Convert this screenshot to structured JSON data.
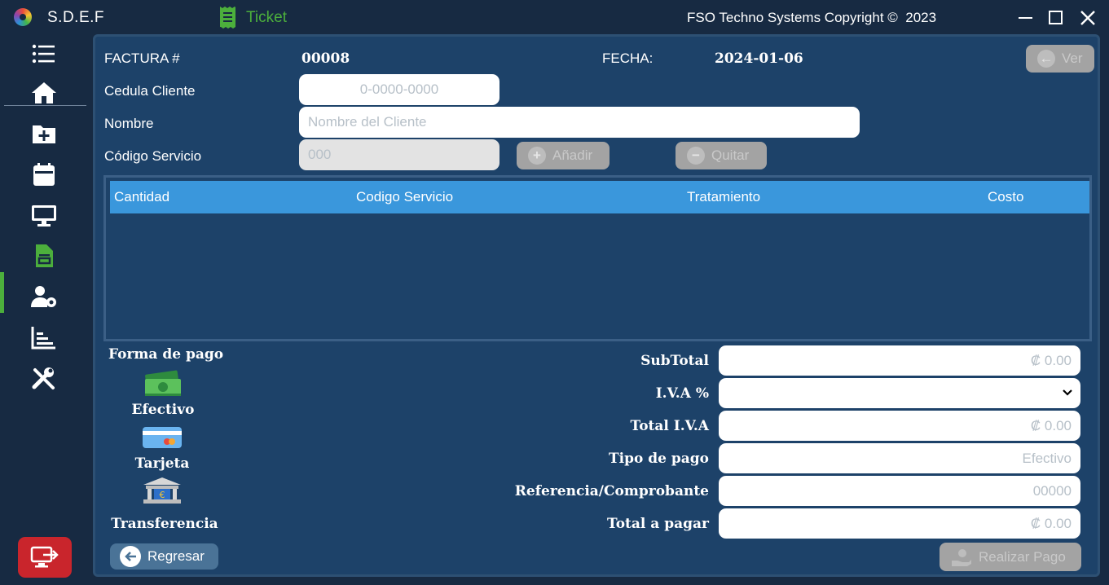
{
  "app": {
    "title": "S.D.E.F",
    "module": "Ticket",
    "copyright": "FSO Techno Systems Copyright ©  2023"
  },
  "sidebar": {
    "items": [
      {
        "icon": "menu-icon"
      },
      {
        "icon": "home-icon"
      },
      {
        "icon": "folder-add-icon"
      },
      {
        "icon": "calendar-icon"
      },
      {
        "icon": "monitor-icon"
      },
      {
        "icon": "document-icon",
        "active": true
      },
      {
        "icon": "user-settings-icon"
      },
      {
        "icon": "chart-icon"
      },
      {
        "icon": "tools-icon"
      }
    ],
    "logout_icon": "logout-icon",
    "active_color": "#4caf3c"
  },
  "header": {
    "factura_label": "FACTURA #",
    "factura_value": "00008",
    "fecha_label": "FECHA:",
    "fecha_value": "2024-01-06",
    "ver_label": "Ver"
  },
  "form": {
    "cedula_label": "Cedula Cliente",
    "cedula_placeholder": "0-0000-0000",
    "nombre_label": "Nombre",
    "nombre_placeholder": "Nombre del Cliente",
    "codigo_label": "Código Servicio",
    "codigo_placeholder": "000",
    "anadir_label": "Añadir",
    "quitar_label": "Quitar"
  },
  "table": {
    "columns": [
      "Cantidad",
      "Codigo Servicio",
      "Tratamiento",
      "Costo"
    ],
    "rows": [],
    "header_color": "#3a97dc"
  },
  "payment": {
    "title": "Forma de pago",
    "methods": [
      {
        "label": "Efectivo",
        "icon": "cash-icon"
      },
      {
        "label": "Tarjeta",
        "icon": "card-icon"
      },
      {
        "label": "Transferencia",
        "icon": "bank-icon"
      }
    ]
  },
  "summary": {
    "subtotal_label": "SubTotal",
    "subtotal_placeholder": "₡ 0.00",
    "iva_label": "I.V.A %",
    "total_iva_label": "Total I.V.A",
    "total_iva_placeholder": "₡ 0.00",
    "tipo_label": "Tipo de pago",
    "tipo_placeholder": "Efectivo",
    "referencia_label": "Referencia/Comprobante",
    "referencia_placeholder": "00000",
    "total_label": "Total a pagar",
    "total_placeholder": "₡ 0.00"
  },
  "actions": {
    "back_label": "Regresar",
    "pay_label": "Realizar Pago"
  }
}
